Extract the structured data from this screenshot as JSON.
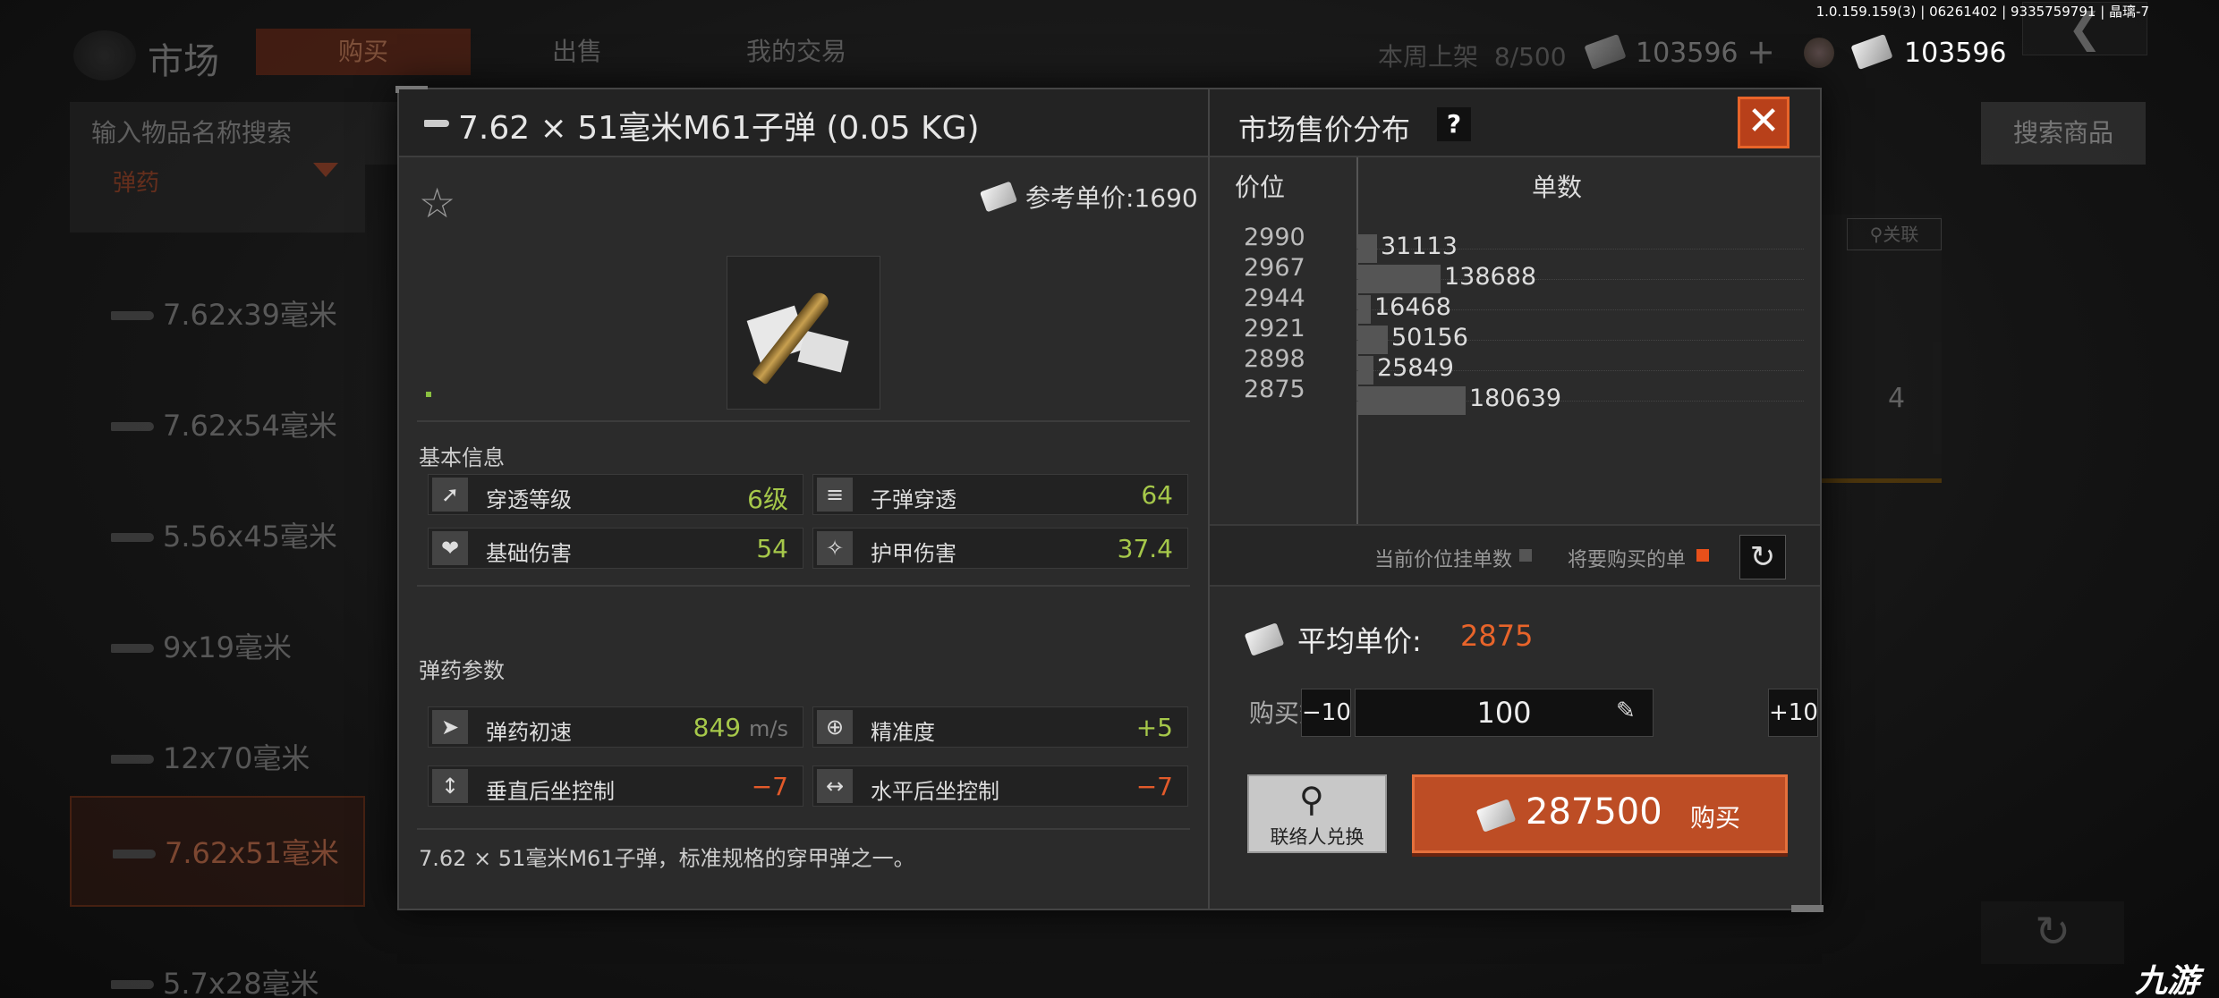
{
  "version": "1.0.159.159(3) | 06261402 | 9335759791 | 晶璃-7",
  "background": {
    "market_title": "市场",
    "tabs": [
      "购买",
      "出售",
      "我的交易"
    ],
    "weekly_listing_label": "本周上架",
    "weekly_listing_value": "8/500",
    "currency_a": "103596",
    "currency_b": "103596",
    "back_icon": "chevron-left-icon",
    "search_placeholder": "输入物品名称搜索",
    "search_goods_label": "搜索商品",
    "category": "弹药",
    "side_items": [
      "7.62x39毫米",
      "7.62x54毫米",
      "5.56x45毫米",
      "9x19毫米",
      "12x70毫米",
      "7.62x51毫米",
      "5.7x28毫米"
    ],
    "active_side_index": 5,
    "associate_label": "关联",
    "right_count": "4"
  },
  "modal": {
    "title": "7.62 × 51毫米M61子弹 (0.05 KG)",
    "market_dist_title": "市场售价分布",
    "help": "?",
    "ref_price_label": "参考单价:1690",
    "basic_info_label": "基本信息",
    "basic_stats": [
      {
        "label": "穿透等级",
        "value": "6级",
        "color": "green",
        "icon": "penetration-icon"
      },
      {
        "label": "子弹穿透",
        "value": "64",
        "color": "green",
        "icon": "bullet-pierce-icon"
      },
      {
        "label": "基础伤害",
        "value": "54",
        "color": "green",
        "icon": "broken-heart-icon"
      },
      {
        "label": "护甲伤害",
        "value": "37.4",
        "color": "green",
        "icon": "armor-damage-icon"
      }
    ],
    "ammo_params_label": "弹药参数",
    "ammo_stats": [
      {
        "label": "弹药初速",
        "value": "849",
        "unit": "m/s",
        "color": "green",
        "icon": "muzzle-velocity-icon"
      },
      {
        "label": "精准度",
        "value": "+5",
        "color": "green",
        "icon": "crosshair-icon"
      },
      {
        "label": "垂直后坐控制",
        "value": "−7",
        "color": "red",
        "icon": "vertical-recoil-icon"
      },
      {
        "label": "水平后坐控制",
        "value": "−7",
        "color": "red",
        "icon": "horizontal-recoil-icon"
      }
    ],
    "description": "7.62 × 51毫米M61子弹，标准规格的穿甲弹之一。"
  },
  "chart_data": {
    "type": "bar",
    "orientation": "horizontal",
    "xlabel": "单数",
    "ylabel": "价位",
    "price_ticks": [
      2990,
      2967,
      2944,
      2921,
      2898,
      2875
    ],
    "categories": [
      2990,
      2967,
      2944,
      2921,
      2898,
      2875
    ],
    "values": [
      31113,
      138688,
      16468,
      50156,
      25849,
      180639
    ],
    "legend": [
      {
        "label": "当前价位挂单数",
        "color": "#555555"
      },
      {
        "label": "将要购买的单",
        "color": "#e8501a"
      }
    ]
  },
  "purchase": {
    "avg_label": "平均单价:",
    "avg_value": "2875",
    "qty_label": "购买数量",
    "minus_label": "−10",
    "plus_label": "+10",
    "quantity": "100",
    "contact_label": "联络人兑换",
    "buy_amount": "287500",
    "buy_label": "购买"
  },
  "colors": {
    "accent": "#e8642a",
    "buy_button": "#bd4d25",
    "positive": "#a6c84a",
    "negative": "#e25a2a"
  },
  "watermark": "九游"
}
